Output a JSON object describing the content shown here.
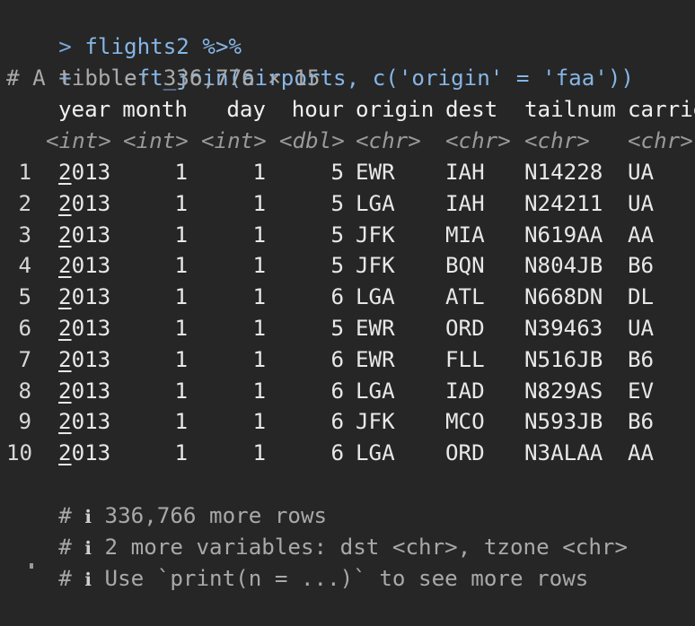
{
  "console": {
    "prompt_symbol": ">",
    "continuation_symbol": "+",
    "input_line1": "flights2 %>%",
    "input_line2": "  left_join(airports, c('origin' = 'faa'))",
    "tibble_header": "# A tibble: 336,776 × 15",
    "columns": [
      {
        "name": "year",
        "type": "<int>"
      },
      {
        "name": "month",
        "type": "<int>"
      },
      {
        "name": "day",
        "type": "<int>"
      },
      {
        "name": "hour",
        "type": "<dbl>"
      },
      {
        "name": "origin",
        "type": "<chr>"
      },
      {
        "name": "dest",
        "type": "<chr>"
      },
      {
        "name": "tailnum",
        "type": "<chr>"
      },
      {
        "name": "carrie",
        "type": "<chr>"
      }
    ],
    "rows": [
      {
        "n": "1",
        "year_first": "2",
        "year_rest": "013",
        "month": "1",
        "day": "1",
        "hour": "5",
        "origin": "EWR",
        "dest": "IAH",
        "tailnum": "N14228",
        "carrier": "UA"
      },
      {
        "n": "2",
        "year_first": "2",
        "year_rest": "013",
        "month": "1",
        "day": "1",
        "hour": "5",
        "origin": "LGA",
        "dest": "IAH",
        "tailnum": "N24211",
        "carrier": "UA"
      },
      {
        "n": "3",
        "year_first": "2",
        "year_rest": "013",
        "month": "1",
        "day": "1",
        "hour": "5",
        "origin": "JFK",
        "dest": "MIA",
        "tailnum": "N619AA",
        "carrier": "AA"
      },
      {
        "n": "4",
        "year_first": "2",
        "year_rest": "013",
        "month": "1",
        "day": "1",
        "hour": "5",
        "origin": "JFK",
        "dest": "BQN",
        "tailnum": "N804JB",
        "carrier": "B6"
      },
      {
        "n": "5",
        "year_first": "2",
        "year_rest": "013",
        "month": "1",
        "day": "1",
        "hour": "6",
        "origin": "LGA",
        "dest": "ATL",
        "tailnum": "N668DN",
        "carrier": "DL"
      },
      {
        "n": "6",
        "year_first": "2",
        "year_rest": "013",
        "month": "1",
        "day": "1",
        "hour": "5",
        "origin": "EWR",
        "dest": "ORD",
        "tailnum": "N39463",
        "carrier": "UA"
      },
      {
        "n": "7",
        "year_first": "2",
        "year_rest": "013",
        "month": "1",
        "day": "1",
        "hour": "6",
        "origin": "EWR",
        "dest": "FLL",
        "tailnum": "N516JB",
        "carrier": "B6"
      },
      {
        "n": "8",
        "year_first": "2",
        "year_rest": "013",
        "month": "1",
        "day": "1",
        "hour": "6",
        "origin": "LGA",
        "dest": "IAD",
        "tailnum": "N829AS",
        "carrier": "EV"
      },
      {
        "n": "9",
        "year_first": "2",
        "year_rest": "013",
        "month": "1",
        "day": "1",
        "hour": "6",
        "origin": "JFK",
        "dest": "MCO",
        "tailnum": "N593JB",
        "carrier": "B6"
      },
      {
        "n": "10",
        "year_first": "2",
        "year_rest": "013",
        "month": "1",
        "day": "1",
        "hour": "6",
        "origin": "LGA",
        "dest": "ORD",
        "tailnum": "N3ALAA",
        "carrier": "AA"
      }
    ],
    "footer": [
      {
        "hash": "#",
        "icon": "ℹ",
        "text": "336,766 more rows"
      },
      {
        "hash": "#",
        "icon": "ℹ",
        "text": "2 more variables: dst <chr>, tzone <chr>"
      },
      {
        "hash": "#",
        "icon": "ℹ",
        "text": "Use `print(n = ...)` to see more rows"
      }
    ],
    "colors": {
      "background": "#262626",
      "prompt": "#7aa8d9",
      "comment": "#a9a9a9",
      "text": "#e8e8e8"
    }
  }
}
